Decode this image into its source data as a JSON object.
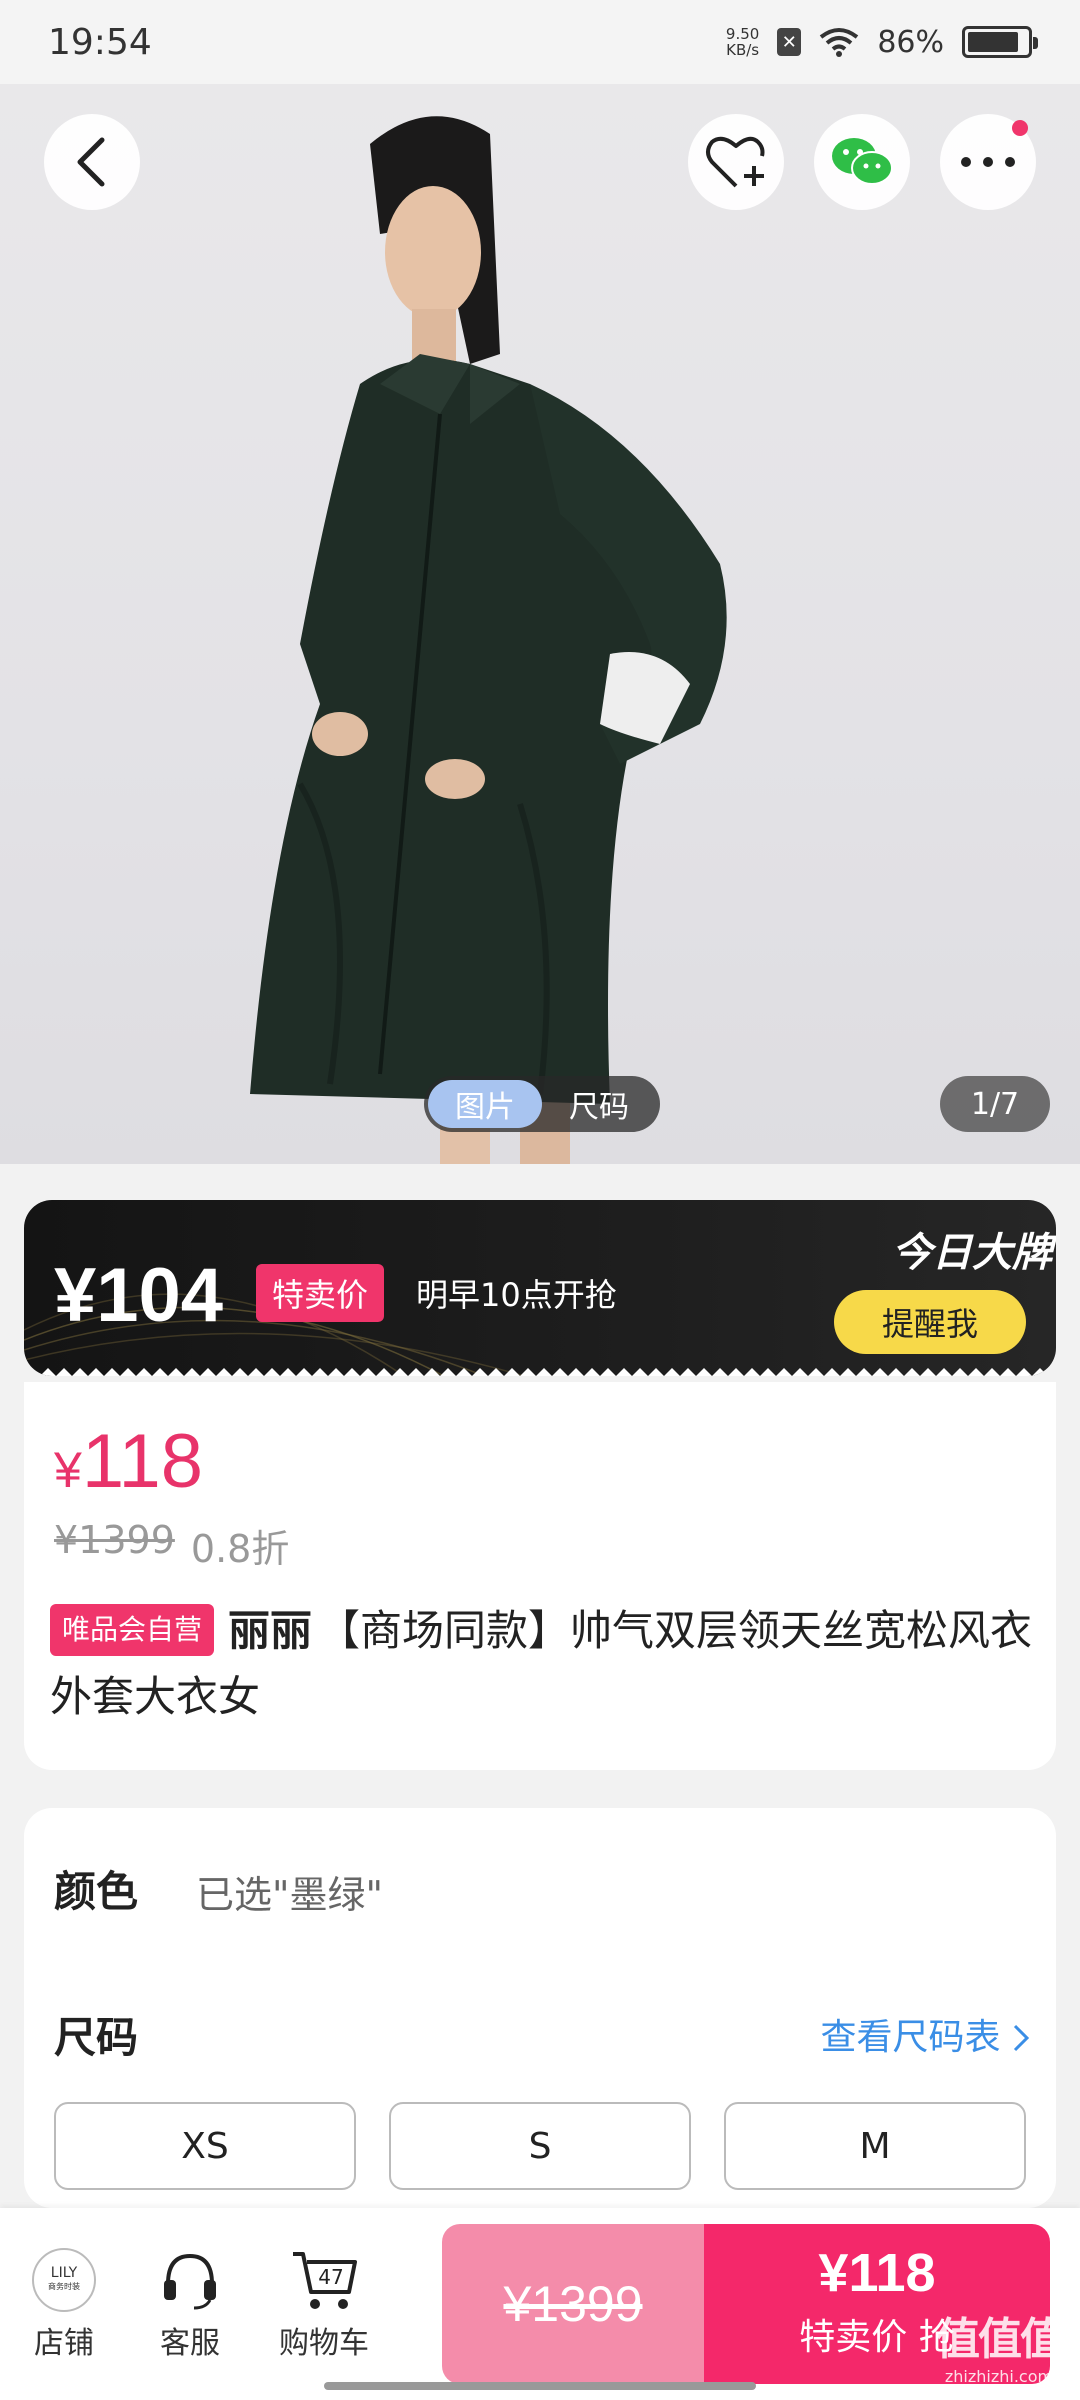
{
  "status_bar": {
    "time": "19:54",
    "net_speed_top": "9.50",
    "net_speed_unit": "KB/s",
    "battery_text": "86%",
    "battery_level": 0.86
  },
  "gallery": {
    "tab_image": "图片",
    "tab_size": "尺码",
    "counter": "1/7",
    "active_tab": "图片"
  },
  "promo": {
    "price": "¥104",
    "badge": "特卖价",
    "note": "明早10点开抢",
    "brand_tag": "今日大牌",
    "remind_button": "提醒我"
  },
  "product": {
    "price_symbol": "¥",
    "price": "118",
    "original_price": "¥1399",
    "discount": "0.8折",
    "self_operated_badge": "唯品会自营",
    "brand": "丽丽",
    "title": "【商场同款】帅气双层领天丝宽松风衣外套大衣女"
  },
  "options": {
    "color_label": "颜色",
    "color_value": "已选\"墨绿\"",
    "size_label": "尺码",
    "size_chart_link": "查看尺码表",
    "sizes": [
      "XS",
      "S",
      "M"
    ]
  },
  "bottom_bar": {
    "store_logo": "LILY",
    "store_logo_sub": "商务时装",
    "store_label": "店铺",
    "service_label": "客服",
    "cart_label": "购物车",
    "cart_count": "47",
    "original_price": "¥1399",
    "buy_price": "¥118",
    "buy_label": "特卖价 抢"
  },
  "watermark": {
    "main": "值值值",
    "url": "zhizhizhi.com"
  },
  "colors": {
    "accent_pink": "#f0356b",
    "buy_pink": "#f4286a",
    "promo_yellow": "#f7d949",
    "link_blue": "#3a8ee6",
    "coat_green": "#1f2d26"
  }
}
